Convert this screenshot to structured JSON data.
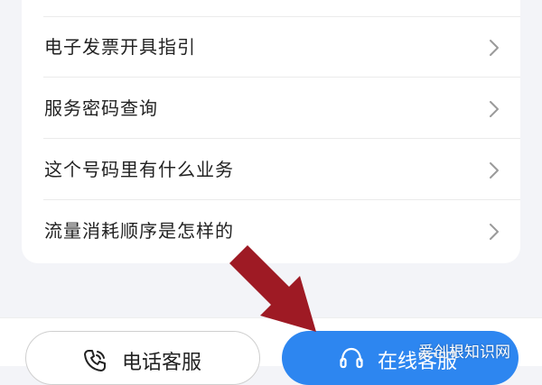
{
  "help_list": {
    "items": [
      {
        "label": "电子发票开具指引",
        "icon": "chevron-right-icon"
      },
      {
        "label": "服务密码查询",
        "icon": "chevron-right-icon"
      },
      {
        "label": "这个号码里有什么业务",
        "icon": "chevron-right-icon"
      },
      {
        "label": "流量消耗顺序是怎样的",
        "icon": "chevron-right-icon"
      }
    ]
  },
  "bottom_bar": {
    "phone_service": {
      "label": "电话客服",
      "icon": "phone-icon"
    },
    "online_service": {
      "label": "在线客服",
      "icon": "headset-icon"
    }
  },
  "overlay": {
    "arrow_icon": "arrow-pointer-icon",
    "watermark": "爱创根知识网"
  },
  "colors": {
    "accent": "#2d86f0",
    "arrow": "#9e1a24",
    "background": "#f3f4f8"
  }
}
